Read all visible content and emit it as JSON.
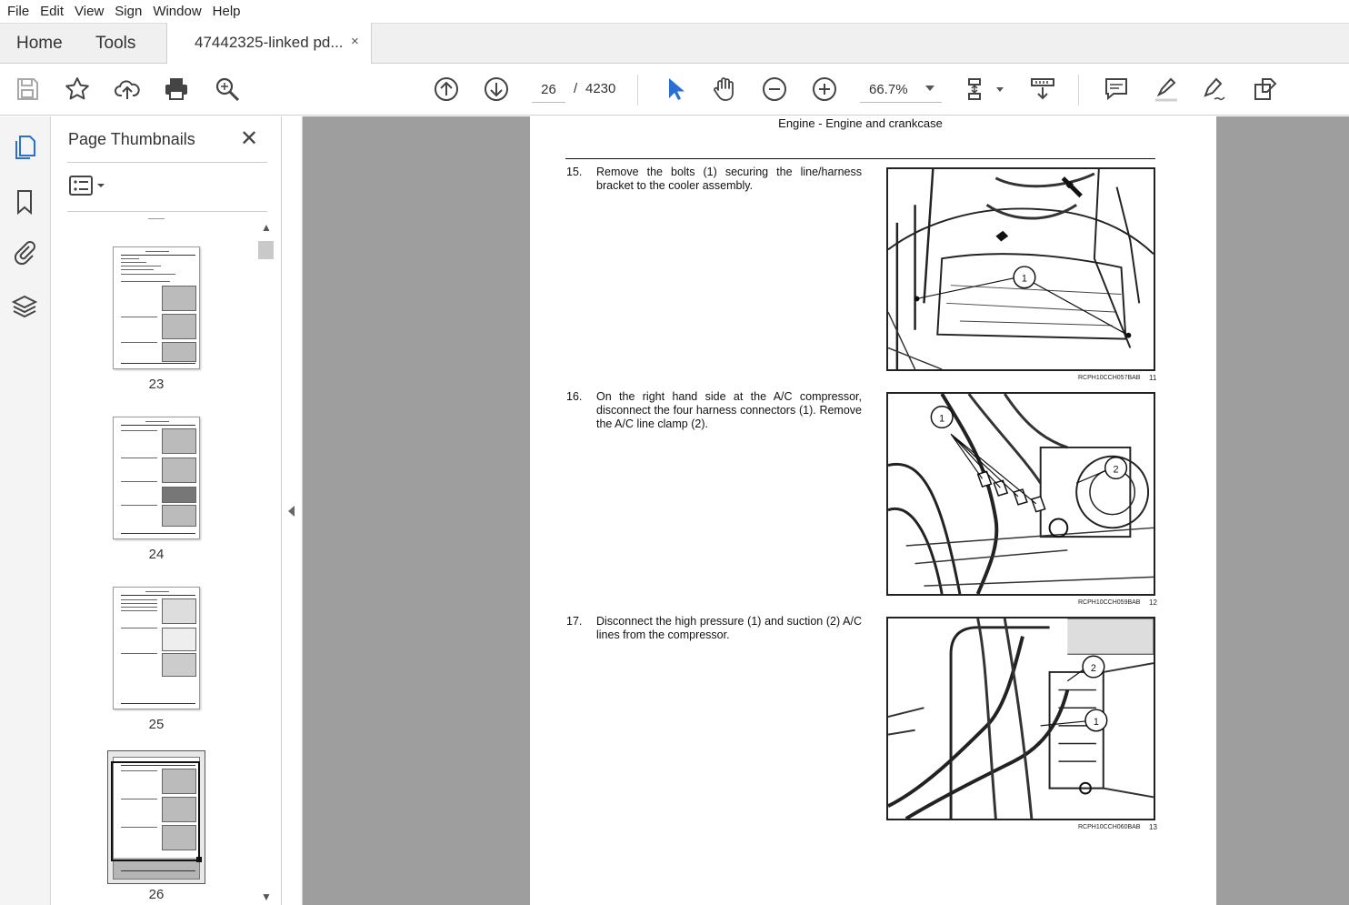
{
  "menu": [
    "File",
    "Edit",
    "View",
    "Sign",
    "Window",
    "Help"
  ],
  "tabs": {
    "home": "Home",
    "tools": "Tools",
    "document": "47442325-linked pd...",
    "close": "×"
  },
  "toolbar": {
    "icons": [
      "save-icon",
      "star-icon",
      "upload-cloud-icon",
      "print-icon",
      "search-zoom-icon",
      "arrow-up-circle-icon",
      "arrow-down-circle-icon",
      "select-cursor-icon",
      "hand-icon",
      "zoom-out-icon",
      "zoom-in-icon",
      "page-fit-icon",
      "scroll-mode-icon",
      "comment-icon",
      "highlight-icon",
      "sign-icon",
      "share-icon"
    ],
    "current_page": "26",
    "separator": "/",
    "total_pages": "4230",
    "zoom": "66.7%",
    "accent": "#2a6fd1"
  },
  "rail": {
    "icons": [
      "pages-icon",
      "bookmark-icon",
      "paperclip-icon",
      "layers-icon"
    ]
  },
  "thumbnails": {
    "title": "Page Thumbnails",
    "close": "✕",
    "pages": [
      {
        "num": "23",
        "selected": false
      },
      {
        "num": "24",
        "selected": false
      },
      {
        "num": "25",
        "selected": false
      },
      {
        "num": "26",
        "selected": true
      }
    ]
  },
  "document": {
    "header": "Engine - Engine and crankcase",
    "steps": [
      {
        "num": "15.",
        "text": "Remove the bolts (1) securing the line/harness bracket to the cooler assembly.",
        "figure_code": "RCPH10CCH057BAB",
        "figure_num": "11",
        "callouts": [
          "1"
        ]
      },
      {
        "num": "16.",
        "text": "On the right hand side at the A/C compressor, disconnect the four harness connectors (1). Remove the A/C line clamp (2).",
        "figure_code": "RCPH10CCH059BAB",
        "figure_num": "12",
        "callouts": [
          "1",
          "2"
        ]
      },
      {
        "num": "17.",
        "text": "Disconnect the high pressure (1) and suction (2) A/C lines from the compressor.",
        "figure_code": "RCPH10CCH060BAB",
        "figure_num": "13",
        "callouts": [
          "2",
          "1"
        ]
      }
    ]
  }
}
